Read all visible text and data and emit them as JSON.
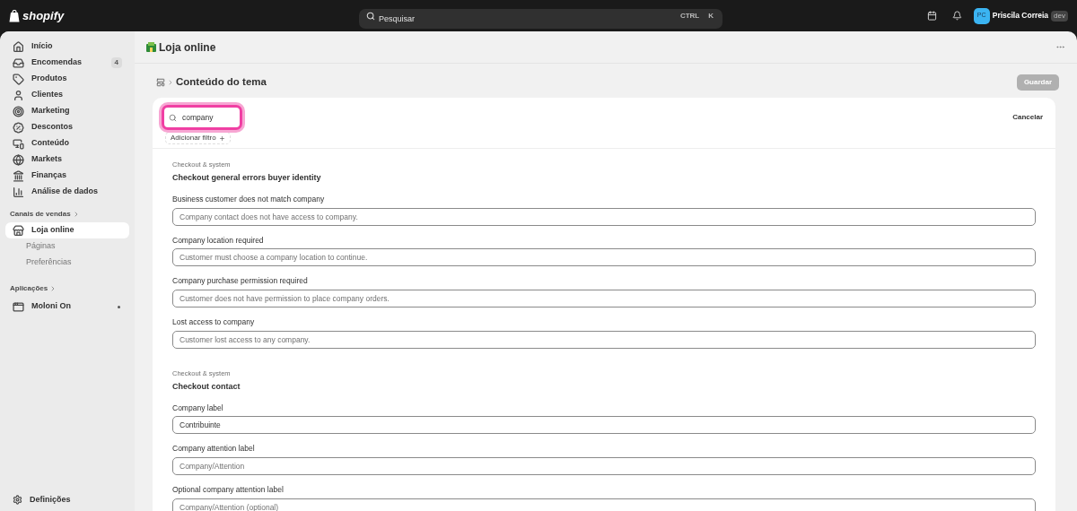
{
  "topbar": {
    "logo": "shopify",
    "search": {
      "placeholder": "Pesquisar",
      "shortcut": [
        "CTRL",
        "K"
      ]
    },
    "user": {
      "initials": "PC",
      "name": "Priscila Correia",
      "badge": "dev"
    }
  },
  "sidebar": {
    "items": [
      {
        "label": "Início",
        "selected": false
      },
      {
        "label": "Encomendas",
        "count": "4",
        "selected": false
      },
      {
        "label": "Produtos",
        "selected": false
      },
      {
        "label": "Clientes",
        "selected": false
      },
      {
        "label": "Marketing",
        "selected": false
      },
      {
        "label": "Descontos",
        "selected": false
      },
      {
        "label": "Conteúdo",
        "selected": false
      },
      {
        "label": "Markets",
        "selected": false
      },
      {
        "label": "Finanças",
        "selected": false
      },
      {
        "label": "Análise de dados",
        "selected": false
      }
    ],
    "sales_channels": {
      "heading": "Canais de vendas",
      "items": [
        {
          "label": "Loja online",
          "selected": true,
          "children": [
            {
              "label": "Páginas",
              "selected": false
            },
            {
              "label": "Preferências",
              "selected": false
            }
          ]
        }
      ]
    },
    "apps": {
      "heading": "Aplicações",
      "items": [
        {
          "label": "Moloni On",
          "selected": false
        }
      ]
    },
    "settings": {
      "label": "Definições"
    }
  },
  "page": {
    "title": "Loja online",
    "breadcrumb": "Conteúdo do tema",
    "save_button": {
      "label": "Guardar",
      "disabled": true
    }
  },
  "filter": {
    "search_value": "company",
    "highlighted": true,
    "cancel": "Cancelar",
    "add_filter": "Adicionar filtro"
  },
  "sections": [
    {
      "category": "Checkout & system",
      "title": "Checkout general errors buyer identity",
      "fields": [
        {
          "label": "Business customer does not match company",
          "placeholder": "Company contact does not have access to company."
        },
        {
          "label": "Company location required",
          "placeholder": "Customer must choose a company location to continue."
        },
        {
          "label": "Company purchase permission required",
          "placeholder": "Customer does not have permission to place company orders."
        },
        {
          "label": "Lost access to company",
          "placeholder": "Customer lost access to any company."
        }
      ]
    },
    {
      "category": "Checkout & system",
      "title": "Checkout contact",
      "fields": [
        {
          "label": "Company label",
          "value": "Contribuinte"
        },
        {
          "label": "Company attention label",
          "placeholder": "Company/Attention"
        },
        {
          "label": "Optional company attention label",
          "placeholder": "Company/Attention (optional)"
        }
      ]
    }
  ]
}
